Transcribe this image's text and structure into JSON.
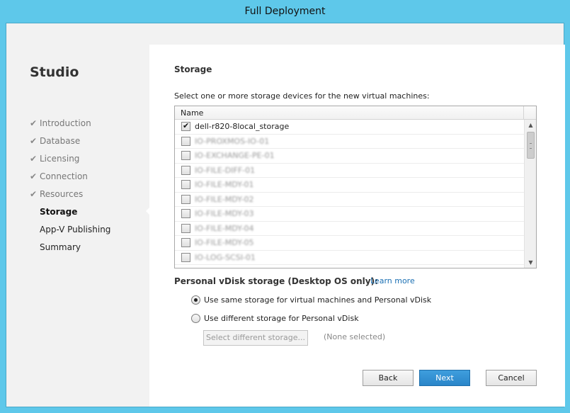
{
  "window": {
    "title": "Full Deployment"
  },
  "sidebar": {
    "app_title": "Studio",
    "steps": [
      {
        "label": "Introduction",
        "state": "done"
      },
      {
        "label": "Database",
        "state": "done"
      },
      {
        "label": "Licensing",
        "state": "done"
      },
      {
        "label": "Connection",
        "state": "done"
      },
      {
        "label": "Resources",
        "state": "done"
      },
      {
        "label": "Storage",
        "state": "active"
      },
      {
        "label": "App-V Publishing",
        "state": "future"
      },
      {
        "label": "Summary",
        "state": "future"
      }
    ],
    "done_icon": "checkmark-icon"
  },
  "main": {
    "section_title": "Storage",
    "instruction": "Select one or more storage devices for the new virtual machines:",
    "grid": {
      "column_name": "Name",
      "rows": [
        {
          "name": "dell-r820-8local_storage",
          "checked": true,
          "obscured": false
        },
        {
          "name": "IO-PROXMOS-IO-01",
          "checked": false,
          "obscured": true
        },
        {
          "name": "IO-EXCHANGE-PE-01",
          "checked": false,
          "obscured": true
        },
        {
          "name": "IO-FILE-DIFF-01",
          "checked": false,
          "obscured": true
        },
        {
          "name": "IO-FILE-MDY-01",
          "checked": false,
          "obscured": true
        },
        {
          "name": "IO-FILE-MDY-02",
          "checked": false,
          "obscured": true
        },
        {
          "name": "IO-FILE-MDY-03",
          "checked": false,
          "obscured": true
        },
        {
          "name": "IO-FILE-MDY-04",
          "checked": false,
          "obscured": true
        },
        {
          "name": "IO-FILE-MDY-05",
          "checked": false,
          "obscured": true
        },
        {
          "name": "IO-LOG-SCSI-01",
          "checked": false,
          "obscured": true
        }
      ]
    },
    "pvd": {
      "label": "Personal vDisk storage (Desktop OS only):",
      "learn_more": "Learn more",
      "options": [
        {
          "label": "Use same storage for virtual machines and Personal vDisk",
          "selected": true
        },
        {
          "label": "Use different storage for Personal vDisk",
          "selected": false
        }
      ],
      "select_button": "Select different storage...",
      "none_selected": "(None selected)"
    },
    "buttons": {
      "back": "Back",
      "next": "Next",
      "cancel": "Cancel"
    }
  },
  "colors": {
    "titlebar": "#5ec8ea",
    "primary_button": "#2a85c9",
    "link": "#1a6fb3"
  }
}
